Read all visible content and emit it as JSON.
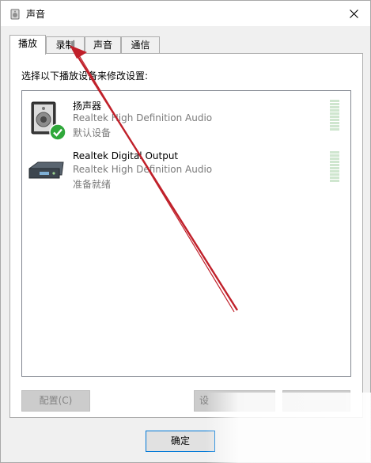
{
  "window": {
    "title": "声音"
  },
  "tabs": [
    {
      "label": "播放",
      "active": true
    },
    {
      "label": "录制",
      "active": false
    },
    {
      "label": "声音",
      "active": false
    },
    {
      "label": "通信",
      "active": false
    }
  ],
  "panel": {
    "instruction": "选择以下播放设备来修改设置:"
  },
  "devices": [
    {
      "name": "扬声器",
      "description": "Realtek High Definition Audio",
      "status": "默认设备",
      "icon": "speaker-icon",
      "is_default": true
    },
    {
      "name": "Realtek Digital Output",
      "description": "Realtek High Definition Audio",
      "status": "准备就绪",
      "icon": "digital-output-icon",
      "is_default": false
    }
  ],
  "buttons": {
    "configure": "配置(C)",
    "set_default": "设",
    "ok": "确定"
  },
  "colors": {
    "accent": "#0078d7",
    "default_check": "#2fa83a",
    "annotation_arrow": "#c0202a",
    "meter": "#cfe6cf"
  }
}
